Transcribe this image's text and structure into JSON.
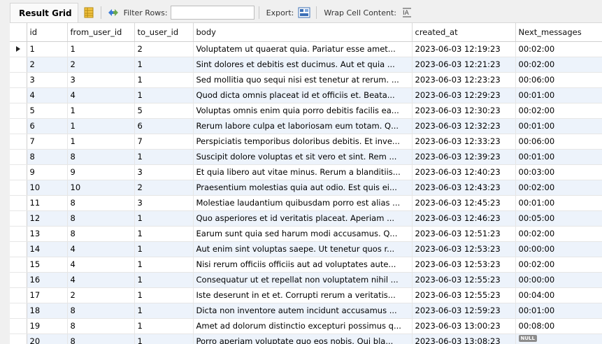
{
  "toolbar": {
    "result_grid_label": "Result Grid",
    "filter_rows_label": "Filter Rows:",
    "filter_value": "",
    "export_label": "Export:",
    "wrap_label": "Wrap Cell Content:"
  },
  "columns": [
    "id",
    "from_user_id",
    "to_user_id",
    "body",
    "created_at",
    "Next_messages"
  ],
  "null_label": "NULL",
  "rows": [
    {
      "id": "1",
      "from": "1",
      "to": "2",
      "body": "Voluptatem ut quaerat quia. Pariatur esse amet...",
      "created": "2023-06-03 12:19:23",
      "next": "00:02:00"
    },
    {
      "id": "2",
      "from": "2",
      "to": "1",
      "body": "Sint dolores et debitis est ducimus. Aut et quia ...",
      "created": "2023-06-03 12:21:23",
      "next": "00:02:00"
    },
    {
      "id": "3",
      "from": "3",
      "to": "1",
      "body": "Sed mollitia quo sequi nisi est tenetur at rerum. ...",
      "created": "2023-06-03 12:23:23",
      "next": "00:06:00"
    },
    {
      "id": "4",
      "from": "4",
      "to": "1",
      "body": "Quod dicta omnis placeat id et officiis et. Beata...",
      "created": "2023-06-03 12:29:23",
      "next": "00:01:00"
    },
    {
      "id": "5",
      "from": "1",
      "to": "5",
      "body": "Voluptas omnis enim quia porro debitis facilis ea...",
      "created": "2023-06-03 12:30:23",
      "next": "00:02:00"
    },
    {
      "id": "6",
      "from": "1",
      "to": "6",
      "body": "Rerum labore culpa et laboriosam eum totam. Q...",
      "created": "2023-06-03 12:32:23",
      "next": "00:01:00"
    },
    {
      "id": "7",
      "from": "1",
      "to": "7",
      "body": "Perspiciatis temporibus doloribus debitis. Et inve...",
      "created": "2023-06-03 12:33:23",
      "next": "00:06:00"
    },
    {
      "id": "8",
      "from": "8",
      "to": "1",
      "body": "Suscipit dolore voluptas et sit vero et sint. Rem ...",
      "created": "2023-06-03 12:39:23",
      "next": "00:01:00"
    },
    {
      "id": "9",
      "from": "9",
      "to": "3",
      "body": "Et quia libero aut vitae minus. Rerum a blanditiis...",
      "created": "2023-06-03 12:40:23",
      "next": "00:03:00"
    },
    {
      "id": "10",
      "from": "10",
      "to": "2",
      "body": "Praesentium molestias quia aut odio. Est quis ei...",
      "created": "2023-06-03 12:43:23",
      "next": "00:02:00"
    },
    {
      "id": "11",
      "from": "8",
      "to": "3",
      "body": "Molestiae laudantium quibusdam porro est alias ...",
      "created": "2023-06-03 12:45:23",
      "next": "00:01:00"
    },
    {
      "id": "12",
      "from": "8",
      "to": "1",
      "body": "Quo asperiores et id veritatis placeat. Aperiam ...",
      "created": "2023-06-03 12:46:23",
      "next": "00:05:00"
    },
    {
      "id": "13",
      "from": "8",
      "to": "1",
      "body": "Earum sunt quia sed harum modi accusamus. Q...",
      "created": "2023-06-03 12:51:23",
      "next": "00:02:00"
    },
    {
      "id": "14",
      "from": "4",
      "to": "1",
      "body": "Aut enim sint voluptas saepe. Ut tenetur quos r...",
      "created": "2023-06-03 12:53:23",
      "next": "00:00:00"
    },
    {
      "id": "15",
      "from": "4",
      "to": "1",
      "body": "Nisi rerum officiis officiis aut ad voluptates aute...",
      "created": "2023-06-03 12:53:23",
      "next": "00:02:00"
    },
    {
      "id": "16",
      "from": "4",
      "to": "1",
      "body": "Consequatur ut et repellat non voluptatem nihil ...",
      "created": "2023-06-03 12:55:23",
      "next": "00:00:00"
    },
    {
      "id": "17",
      "from": "2",
      "to": "1",
      "body": "Iste deserunt in et et. Corrupti rerum a veritatis...",
      "created": "2023-06-03 12:55:23",
      "next": "00:04:00"
    },
    {
      "id": "18",
      "from": "8",
      "to": "1",
      "body": "Dicta non inventore autem incidunt accusamus ...",
      "created": "2023-06-03 12:59:23",
      "next": "00:01:00"
    },
    {
      "id": "19",
      "from": "8",
      "to": "1",
      "body": "Amet ad dolorum distinctio excepturi possimus q...",
      "created": "2023-06-03 13:00:23",
      "next": "00:08:00"
    },
    {
      "id": "20",
      "from": "8",
      "to": "1",
      "body": "Porro aperiam voluptate quo eos nobis. Qui bla...",
      "created": "2023-06-03 13:08:23",
      "next": null
    }
  ]
}
